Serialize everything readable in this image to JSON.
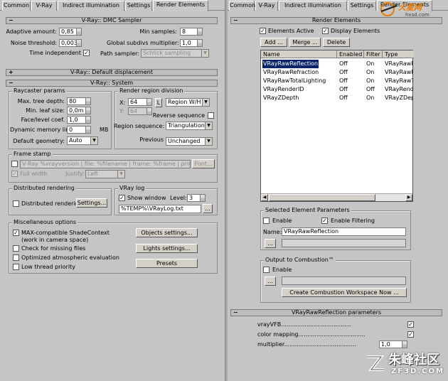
{
  "left_tabs": [
    "Common",
    "V-Ray",
    "Indirect illumination",
    "Settings",
    "Render Elements"
  ],
  "right_tabs": [
    "Common",
    "V-Ray",
    "Indirect illumination",
    "Settings",
    "Render Elements"
  ],
  "dmc": {
    "title": "V-Ray:: DMC Sampler",
    "adaptive_amount_label": "Adaptive amount:",
    "adaptive_amount": "0,85",
    "min_samples_label": "Min samples:",
    "min_samples": "8",
    "noise_threshold_label": "Noise threshold:",
    "noise_threshold": "0,003",
    "global_subdivs_label": "Global subdivs multiplier:",
    "global_subdivs": "1,0",
    "time_independent_label": "Time independent",
    "path_sampler_label": "Path sampler:",
    "path_sampler": "Schlick sampling"
  },
  "displacement": {
    "title": "V-Ray:: Default displacement"
  },
  "system": {
    "title": "V-Ray:: System",
    "raycaster": {
      "title": "Raycaster params",
      "max_depth_label": "Max. tree depth:",
      "max_depth": "80",
      "min_leaf_label": "Min. leaf size:",
      "min_leaf": "0,0m",
      "face_coef_label": "Face/level coef.",
      "face_coef": "1,0",
      "dyn_mem_label": "Dynamic memory limit:",
      "dyn_mem": "0",
      "dyn_mem_unit": "MB",
      "default_geom_label": "Default geometry:",
      "default_geom": "Auto"
    },
    "region": {
      "title": "Render region division",
      "x_label": "X:",
      "x": "64",
      "y_label": "Y:",
      "y": "64",
      "l_btn": "L",
      "mode": "Region W/H",
      "reverse_label": "Reverse sequence",
      "seq_label": "Region sequence:",
      "seq": "Triangulation",
      "prev_label": "Previous",
      "prev": "Unchanged"
    },
    "frame_stamp": {
      "title": "Frame stamp",
      "text": "V-Ray %vrayversion | file: %filename | frame: %frame | primitives: %",
      "font_btn": "Font...",
      "full_width_label": "Full width",
      "justify_label": "Justify:",
      "justify": "Left"
    },
    "distributed": {
      "title": "Distributed rendering",
      "check_label": "Distributed rendering",
      "settings_btn": "Settings..."
    },
    "vraylog": {
      "title": "VRay log",
      "show_label": "Show window",
      "level_label": "Level:",
      "level": "3",
      "path": "%TEMP%\\VRayLog.txt",
      "browse_btn": "..."
    },
    "misc": {
      "title": "Miscellaneous options",
      "opt1": "MAX-compatible ShadeContext",
      "opt1b": "(work in camera space)",
      "opt2": "Check for missing files",
      "opt3": "Optimized atmospheric evaluation",
      "opt4": "Low thread priority",
      "objects_btn": "Objects settings...",
      "lights_btn": "Lights settings...",
      "presets_btn": "Presets"
    }
  },
  "render_elements": {
    "title": "Render Elements",
    "elements_active_label": "Elements Active",
    "display_elements_label": "Display Elements",
    "add_btn": "Add ...",
    "merge_btn": "Merge ...",
    "delete_btn": "Delete",
    "columns": [
      "Name",
      "Enabled",
      "Filter",
      "Type"
    ],
    "rows": [
      [
        "VRayRawReflection",
        "Off",
        "On",
        "VRayRawR"
      ],
      [
        "VRayRawRefraction",
        "Off",
        "On",
        "VRayRawR"
      ],
      [
        "VRayRawTotalLighting",
        "Off",
        "On",
        "VRayRawTot"
      ],
      [
        "VRayRenderID",
        "Off",
        "Off",
        "VRayRend"
      ],
      [
        "VRayZDepth",
        "Off",
        "On",
        "VRayZDep"
      ]
    ],
    "selected": {
      "title": "Selected Element Parameters",
      "enable_label": "Enable",
      "filtering_label": "Enable Filtering",
      "name_label": "Name:",
      "name": "VRayRawReflection",
      "browse_btn": "..."
    },
    "combustion": {
      "title": "Output to Combustion™",
      "enable_label": "Enable",
      "browse_btn": "...",
      "create_btn": "Create Combustion Workspace Now ..."
    }
  },
  "params": {
    "title": "VRayRawReflection parameters",
    "vrayvfb_label": "vrayVFB.......................................",
    "color_mapping_label": "color mapping.....................................",
    "multiplier_label": "multiplier........................................",
    "multiplier": "1,0"
  },
  "watermarks": {
    "top": "hxsd.com",
    "bottom_cn": "朱峰社区",
    "bottom_url": "ZF3D.COM"
  }
}
